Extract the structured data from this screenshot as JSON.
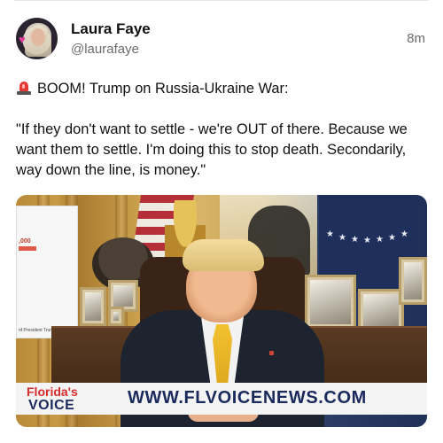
{
  "post": {
    "author_name": "Laura Faye",
    "author_handle": "@laurafaye",
    "timestamp": "8m",
    "headline": "BOOM! Trump on Russia-Ukraine War:",
    "quote": "\"If they don't want to settle - we're OUT of there. Because we want them to settle. I'm doing this to stop death. Secondarily, way down the line, is money.\""
  },
  "media": {
    "whiteboard_number": ",000",
    "whiteboard_caption": "of President Trump",
    "banner_logo_top": "Florida's",
    "banner_logo_bottom": "VOICE",
    "banner_url": "WWW.FLVOICENEWS.COM"
  },
  "icons": {
    "headline_icon": "siren-emoji",
    "avatar": "profile-photo"
  },
  "colors": {
    "text_primary": "#111111",
    "text_secondary": "#6b6b6b",
    "banner_navy": "#1b2a5c",
    "banner_red": "#d62b2b"
  }
}
